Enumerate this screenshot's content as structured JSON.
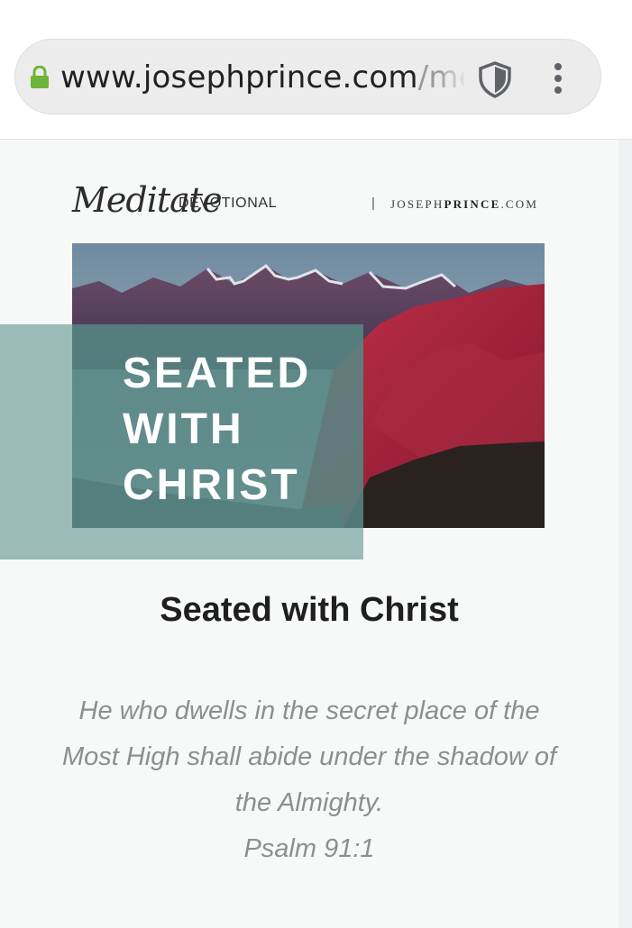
{
  "browser": {
    "url_host": "www.josephprince.com",
    "url_path": "/me",
    "icons": {
      "lock": "lock-icon",
      "shield": "shield-icon",
      "menu": "kebab-menu-icon"
    },
    "lock_color": "#6fb43a"
  },
  "header": {
    "script_word": "Meditate",
    "devotional_label": "DEVOTIONAL",
    "separator": "|",
    "site_plain_1": "JOSEPH",
    "site_bold": "PRINCE",
    "site_plain_2": ".COM"
  },
  "hero": {
    "line1": "SEATED",
    "line2": "WITH",
    "line3": "CHRIST"
  },
  "article": {
    "title": "Seated with Christ",
    "verse_line1": "He who dwells in the secret place of the",
    "verse_line2": "Most High shall abide under the shadow of",
    "verse_line3": "the Almighty.",
    "reference": "Psalm 91:1"
  }
}
